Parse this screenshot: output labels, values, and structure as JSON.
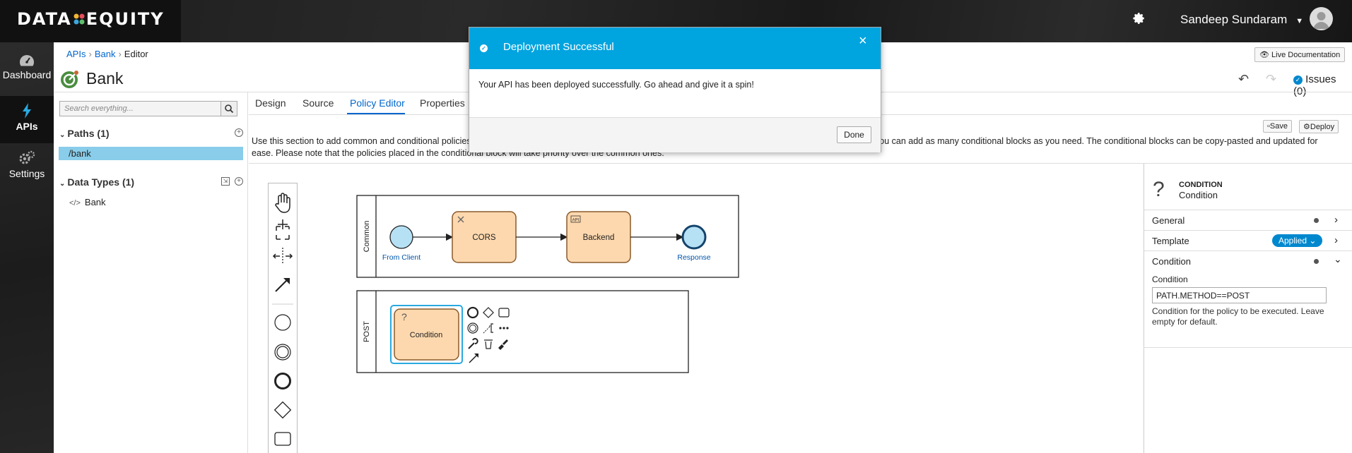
{
  "header": {
    "logo_text_left": "DATA",
    "logo_text_right": "EQUITY",
    "user_name": "Sandeep Sundaram"
  },
  "sidenav": {
    "items": [
      {
        "label": "Dashboard",
        "icon": "dashboard-icon"
      },
      {
        "label": "APIs",
        "icon": "bolt-icon",
        "active": true
      },
      {
        "label": "Settings",
        "icon": "gears-icon"
      }
    ]
  },
  "breadcrumb": {
    "items": [
      "APIs",
      "Bank",
      "Editor"
    ]
  },
  "toolbar": {
    "live_docs_label": "Live Documentation",
    "issues_label": "Issues (0)",
    "save_label": "Save",
    "deploy_label": "Deploy"
  },
  "api": {
    "title": "Bank"
  },
  "left": {
    "search_placeholder": "Search everything...",
    "paths_title": "Paths (1)",
    "paths": [
      "/bank"
    ],
    "datatypes_title": "Data Types (1)",
    "datatypes": [
      "Bank"
    ]
  },
  "tabs": [
    "Design",
    "Source",
    "Policy Editor",
    "Properties"
  ],
  "active_tab": "Policy Editor",
  "description": "Use this section to add common and conditional policies ",
  "description_tail": "You can add as many conditional blocks as you need. The conditional blocks can be copy-pasted and updated for",
  "description_line2": "ease. Please note that the policies placed in the conditional block will take priority over the common ones.",
  "diagram": {
    "lane_common": "Common",
    "lane_post": "POST",
    "from_client": "From Client",
    "cors": "CORS",
    "backend": "Backend",
    "response": "Response",
    "condition": "Condition",
    "api_badge": "API"
  },
  "right_panel": {
    "header_type": "CONDITION",
    "header_name": "Condition",
    "rows": {
      "general": "General",
      "template": "Template",
      "template_badge": "Applied",
      "condition": "Condition"
    },
    "field_label": "Condition",
    "field_value": "PATH.METHOD==POST",
    "field_help": "Condition for the policy to be executed. Leave empty for default."
  },
  "modal": {
    "title": "Deployment Successful",
    "body": "Your API has been deployed successfully. Go ahead and give it a spin!",
    "done_label": "Done"
  },
  "colors": {
    "accent": "#0066cc",
    "modal_header": "#00a4df",
    "selected_path": "#89cdea",
    "task_fill": "#fdd8ae",
    "event_fill": "#b6e1f5",
    "applied_badge": "#0088ce"
  }
}
